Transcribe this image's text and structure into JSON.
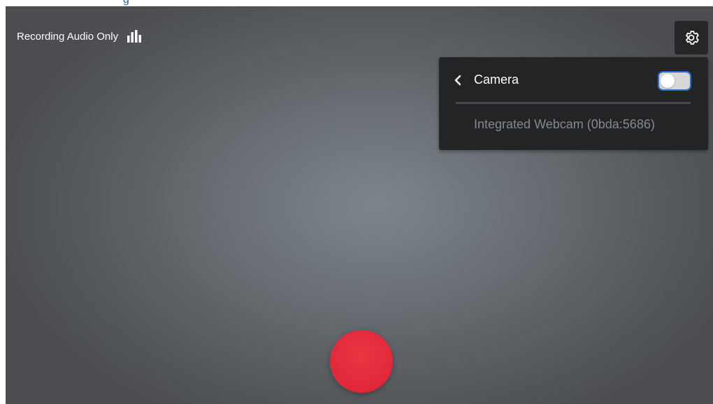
{
  "top_strip": {
    "text": "g"
  },
  "status": {
    "label": "Recording Audio Only",
    "icon": "audio-level-bars-icon"
  },
  "settings_button": {
    "icon": "gear-icon"
  },
  "camera_menu": {
    "title": "Camera",
    "back_icon": "chevron-left-icon",
    "toggle_state": "off",
    "items": [
      {
        "label": "Integrated Webcam (0bda:5686)"
      }
    ]
  },
  "record_button": {
    "color": "#e2293a"
  },
  "colors": {
    "accent_focus": "#2f6fd6",
    "menu_bg": "#222426",
    "record_red": "#e2293a"
  }
}
